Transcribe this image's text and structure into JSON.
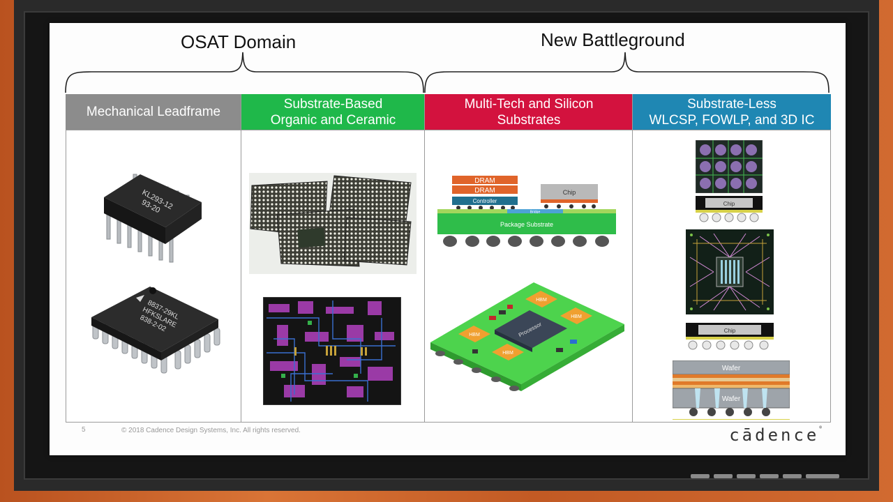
{
  "slide": {
    "left_domain": "OSAT Domain",
    "right_domain": "New Battleground",
    "columns": [
      {
        "line1": "Mechanical Leadframe",
        "line2": "",
        "color": "#8c8c8c"
      },
      {
        "line1": "Substrate-Based",
        "line2": "Organic and Ceramic",
        "color": "#1fb84a"
      },
      {
        "line1": "Multi-Tech and Silicon",
        "line2": "Substrates",
        "color": "#d3123e"
      },
      {
        "line1": "Substrate-Less",
        "line2": "WLCSP, FOWLP, and 3D IC",
        "color": "#1f87b3"
      }
    ],
    "chip_labels": {
      "dip_marking_1": "KL293-12",
      "dip_marking_2": "93-20",
      "qfp_marking_1": "8837-29KL",
      "qfp_marking_2": "HFKSLARE",
      "qfp_marking_3": "838-2-02"
    },
    "multitech": {
      "dram": "DRAM",
      "controller": "Controller",
      "chip": "Chip",
      "bridge": "Bridge",
      "substrate": "Package Substrate",
      "processor": "Processor",
      "hbm": "HBM"
    },
    "substrateless": {
      "chip": "Chip",
      "wafer": "Wafer"
    },
    "page_number": "5",
    "copyright": "© 2018 Cadence Design Systems, Inc. All rights reserved.",
    "logo": "cādence"
  }
}
